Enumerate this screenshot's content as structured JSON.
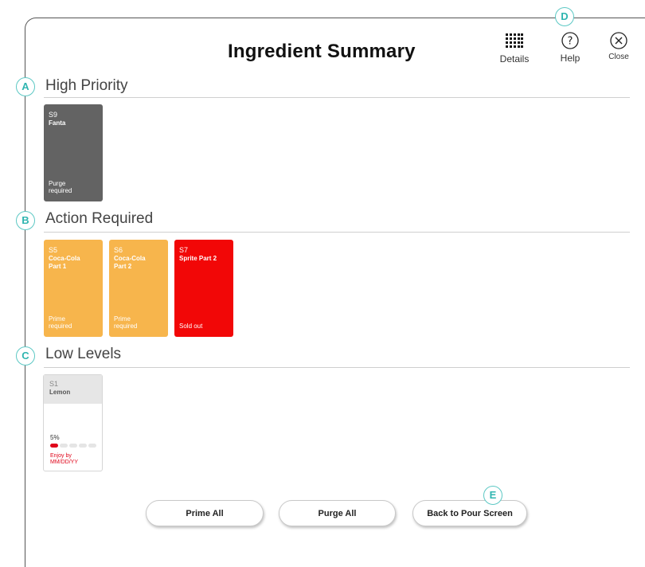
{
  "header": {
    "title": "Ingredient Summary",
    "details_label": "Details",
    "help_label": "Help",
    "close_label": "Close"
  },
  "sections": {
    "high_priority": {
      "badge": "A",
      "title": "High Priority",
      "cards": [
        {
          "code": "S9",
          "name": "Fanta",
          "status": "Purge required"
        }
      ]
    },
    "action_required": {
      "badge": "B",
      "title": "Action Required",
      "cards": [
        {
          "code": "S5",
          "name": "Coca-Cola Part 1",
          "status": "Prime required"
        },
        {
          "code": "S6",
          "name": "Coca-Cola Part 2",
          "status": "Prime required"
        },
        {
          "code": "S7",
          "name": "Sprite Part 2",
          "status": "Sold out"
        }
      ]
    },
    "low_levels": {
      "badge": "C",
      "title": "Low Levels",
      "cards": [
        {
          "code": "S1",
          "name": "Lemon",
          "percent_label": "5%",
          "level_fraction": 0.05,
          "note": "Enjoy by MM/DD/YY"
        }
      ]
    }
  },
  "callouts": {
    "d": "D",
    "e": "E"
  },
  "footer": {
    "prime_all": "Prime All",
    "purge_all": "Purge All",
    "back": "Back to Pour Screen"
  },
  "colors": {
    "accent": "#5cc8c4",
    "high_priority_card": "#636363",
    "action_card": "#f7b54c",
    "sold_out_card": "#f20707",
    "low_level_indicator": "#e0061b"
  },
  "icons": [
    "grid-icon",
    "help-icon",
    "close-icon"
  ]
}
